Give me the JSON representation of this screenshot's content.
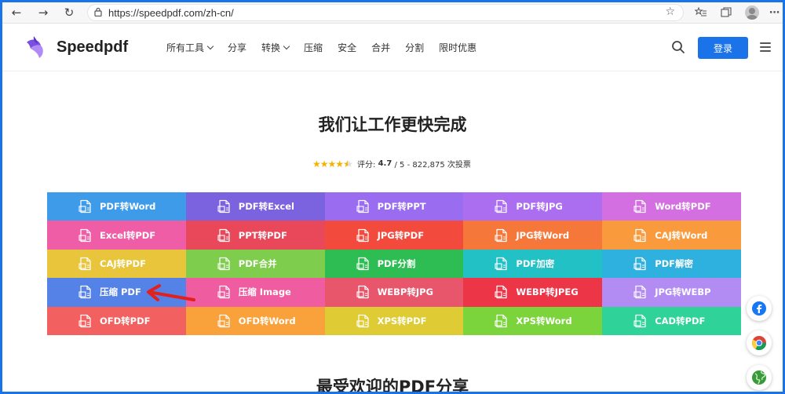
{
  "browser": {
    "url": "https://speedpdf.com/zh-cn/"
  },
  "header": {
    "brand": "Speedpdf",
    "nav": [
      {
        "label": "所有工具",
        "has_caret": true
      },
      {
        "label": "分享",
        "has_caret": false
      },
      {
        "label": "转换",
        "has_caret": true
      },
      {
        "label": "压缩",
        "has_caret": false
      },
      {
        "label": "安全",
        "has_caret": false
      },
      {
        "label": "合并",
        "has_caret": false
      },
      {
        "label": "分割",
        "has_caret": false
      },
      {
        "label": "限时优惠",
        "has_caret": false
      }
    ],
    "login_label": "登录"
  },
  "hero": {
    "title": "我们让工作更快完成",
    "rating_prefix": "评分:",
    "rating_value": "4.7",
    "rating_suffix": "/ 5 - 822,875 次投票",
    "stars": 4.5
  },
  "tools": [
    {
      "label": "PDF转Word",
      "color": "#3d9be9"
    },
    {
      "label": "PDF转Excel",
      "color": "#7b63e0"
    },
    {
      "label": "PDF转PPT",
      "color": "#9a6cf0"
    },
    {
      "label": "PDF转JPG",
      "color": "#ac6ef0"
    },
    {
      "label": "Word转PDF",
      "color": "#d36fe0"
    },
    {
      "label": "Excel转PDF",
      "color": "#ef5da6"
    },
    {
      "label": "PPT转PDF",
      "color": "#e9485a"
    },
    {
      "label": "JPG转PDF",
      "color": "#f24a3c"
    },
    {
      "label": "JPG转Word",
      "color": "#f6773a"
    },
    {
      "label": "CAJ转Word",
      "color": "#f99a3c"
    },
    {
      "label": "CAJ转PDF",
      "color": "#e9c53c"
    },
    {
      "label": "PDF合并",
      "color": "#7fcd4c"
    },
    {
      "label": "PDF分割",
      "color": "#2dbd52"
    },
    {
      "label": "PDF加密",
      "color": "#21c1c6"
    },
    {
      "label": "PDF解密",
      "color": "#2fb1e0"
    },
    {
      "label": "压缩 PDF",
      "color": "#5582e6"
    },
    {
      "label": "压缩 Image",
      "color": "#ef5c9f"
    },
    {
      "label": "WEBP转JPG",
      "color": "#e8566c"
    },
    {
      "label": "WEBP转JPEG",
      "color": "#ec3547"
    },
    {
      "label": "JPG转WEBP",
      "color": "#b28cf2"
    },
    {
      "label": "OFD转PDF",
      "color": "#f26060"
    },
    {
      "label": "OFD转Word",
      "color": "#f9a13a"
    },
    {
      "label": "XPS转PDF",
      "color": "#dfcc35"
    },
    {
      "label": "XPS转Word",
      "color": "#7cd43c"
    },
    {
      "label": "CAD转PDF",
      "color": "#2fd39a"
    }
  ],
  "section2": {
    "title": "最受欢迎的PDF分享"
  },
  "share": [
    "facebook-icon",
    "chrome-icon",
    "web-icon"
  ]
}
